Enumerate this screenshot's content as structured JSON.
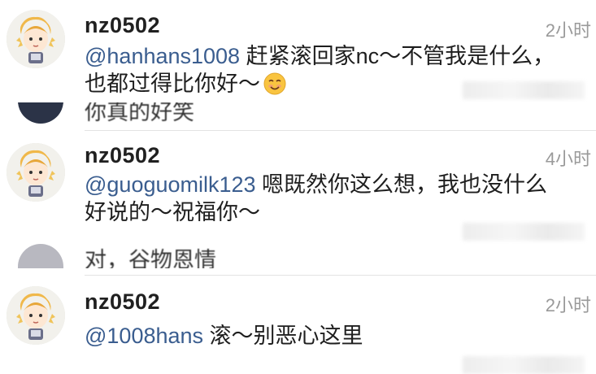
{
  "comments": [
    {
      "username": "nz0502",
      "time": "2小时",
      "mention": "@hanhans1008",
      "text_line1": " 赶紧滚回家nc～不管我是什么，",
      "text_line2": "也都过得比你好～",
      "emoji": "smiling-face-emoji"
    },
    {
      "username": "nz0502",
      "time": "4小时",
      "mention": "@guoguomilk123",
      "text_line1": " 嗯既然你这么想，我也没什么",
      "text_line2": "好说的～祝福你～"
    },
    {
      "username": "nz0502",
      "time": "2小时",
      "mention": "@1008hans",
      "text_line1": " 滚～别恶心这里"
    }
  ],
  "peeks": [
    {
      "text": "你真的好笑"
    },
    {
      "text": "对，谷物恩情"
    }
  ],
  "colors": {
    "mention": "#3a5d8f",
    "username": "#202020",
    "time": "#9a9a9a"
  },
  "icons": {
    "avatar": "cartoon-girl-avatar-icon",
    "emoji": "smiling-face-emoji-icon"
  }
}
